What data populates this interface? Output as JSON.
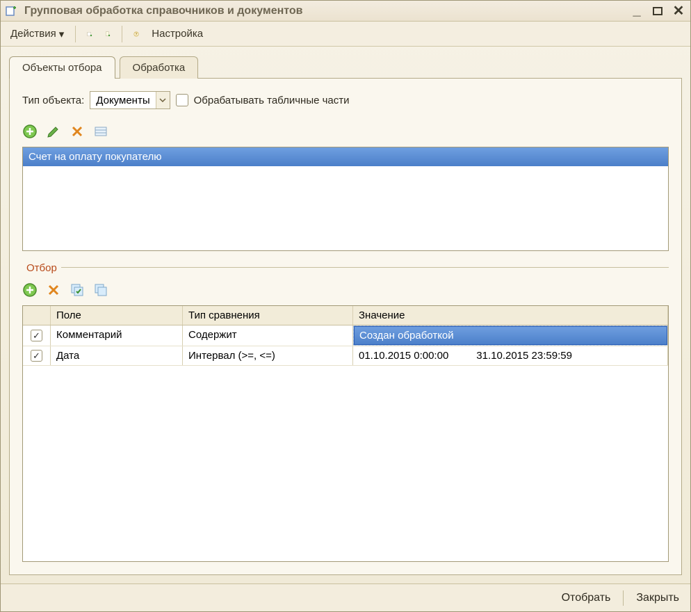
{
  "window": {
    "title": "Групповая обработка справочников и документов"
  },
  "toolbar": {
    "actions_label": "Действия",
    "settings_label": "Настройка"
  },
  "tabs": {
    "tab1": "Объекты отбора",
    "tab2": "Обработка"
  },
  "object_type": {
    "label": "Тип объекта:",
    "value": "Документы",
    "process_tabular_label": "Обрабатывать табличные части"
  },
  "list": {
    "selected": "Счет на оплату покупателю"
  },
  "filter": {
    "title": "Отбор",
    "headers": {
      "field": "Поле",
      "comparison": "Тип сравнения",
      "value": "Значение"
    },
    "rows": [
      {
        "checked": true,
        "field": "Комментарий",
        "comparison": "Содержит",
        "value": "Создан обработкой",
        "highlighted": true
      },
      {
        "checked": true,
        "field": "Дата",
        "comparison": "Интервал (>=, <=)",
        "value_from": "01.10.2015 0:00:00",
        "value_to": "31.10.2015 23:59:59"
      }
    ]
  },
  "footer": {
    "select_label": "Отобрать",
    "close_label": "Закрыть"
  }
}
